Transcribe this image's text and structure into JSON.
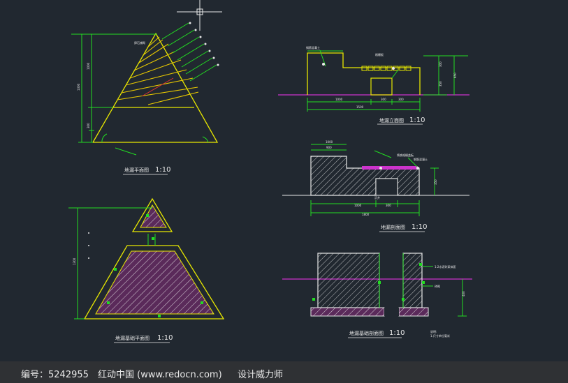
{
  "colors": {
    "background": "#212830",
    "outline": "#e8e800",
    "dimension": "#22dd22",
    "hatch": "#e8e8e8",
    "ground": "#cc33cc",
    "hatch_fill": "#d04fd0",
    "title": "#e8e8e8",
    "footer_bg": "#2f3134"
  },
  "drawings": {
    "plan_view": {
      "title": "地漏平面图",
      "scale": "1:10"
    },
    "bottom_plan": {
      "title": "地漏基础平面图",
      "scale": "1:10"
    },
    "elevation": {
      "title": "地漏立面图",
      "scale": "1:10"
    },
    "section": {
      "title": "地漏剖面图",
      "scale": "1:10"
    },
    "foundation_section": {
      "title": "地漏基础剖面图",
      "scale": "1:10"
    }
  },
  "footer": {
    "id_label": "编号：5242955",
    "site_label": "红动中国 (www.redocn.com)",
    "designer_label": "设计威力师"
  }
}
